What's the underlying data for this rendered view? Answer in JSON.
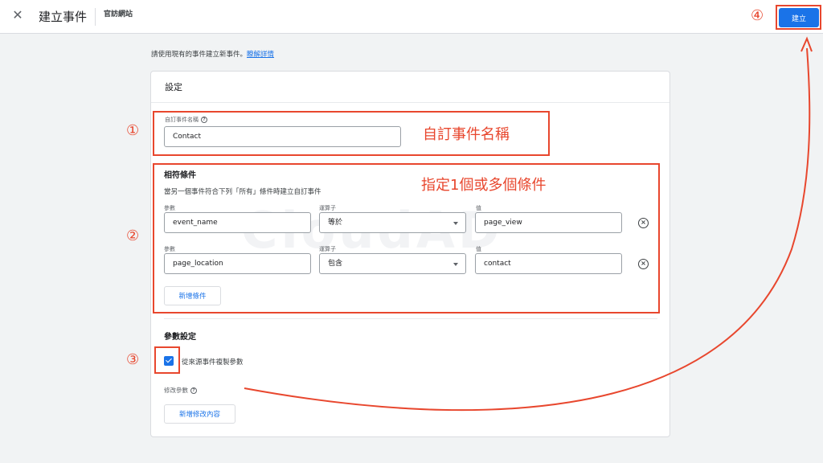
{
  "header": {
    "close_glyph": "✕",
    "title": "建立事件",
    "subtitle": "官訪網站",
    "create_label": "建立"
  },
  "hint": {
    "text": "請使用現有的事件建立新事件。",
    "link": "瞭解詳情"
  },
  "settings": {
    "title": "設定",
    "custom_name_label": "自訂事件名稱",
    "custom_name_value": "Contact"
  },
  "conditions": {
    "title": "相符條件",
    "description": "當另一個事件符合下列「所有」條件時建立自訂事件",
    "rows": [
      {
        "param_label": "參數",
        "param_value": "event_name",
        "op_label": "運算子",
        "op_value": "等於",
        "val_label": "值",
        "val_value": "page_view"
      },
      {
        "param_label": "參數",
        "param_value": "page_location",
        "op_label": "運算子",
        "op_value": "包含",
        "val_label": "值",
        "val_value": "contact"
      }
    ],
    "add_label": "新增條件"
  },
  "params": {
    "title": "參數設定",
    "copy_label": "從來源事件複製參數",
    "copy_checked": true,
    "modify_label": "修改參數",
    "add_modify_label": "新增修改內容"
  },
  "watermark": "CloudAD",
  "annotations": {
    "n1": "①",
    "n2": "②",
    "n3": "③",
    "n4": "④",
    "text1": "自訂事件名稱",
    "text2": "指定1個或多個條件"
  },
  "colors": {
    "accent": "#1a73e8",
    "annotation": "#e8472e",
    "background": "#f1f3f4"
  }
}
